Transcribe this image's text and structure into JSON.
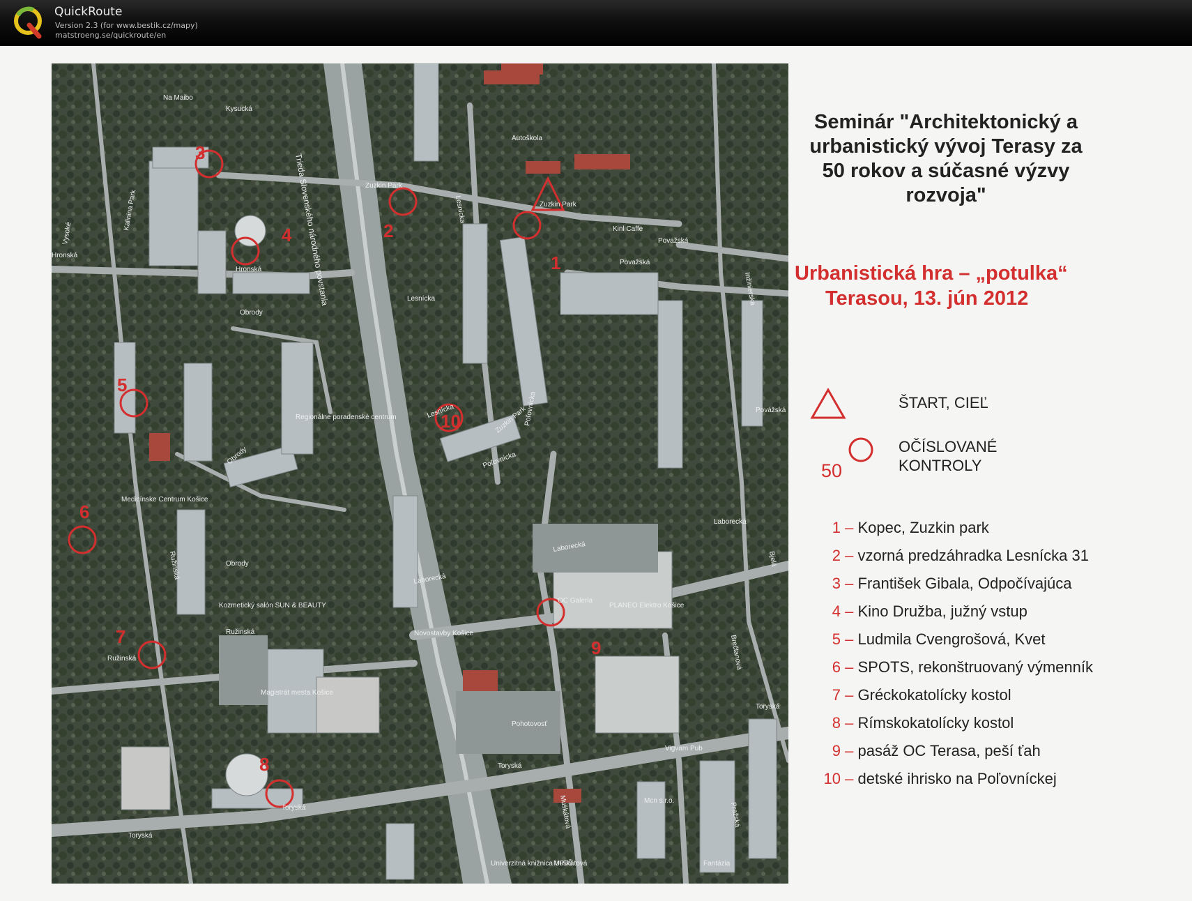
{
  "app": {
    "title": "QuickRoute",
    "version": "Version 2.3  (for www.bestik.cz/mapy)",
    "url": "matstroeng.se/quickroute/en"
  },
  "colors": {
    "accent_red": "#d32f2f",
    "header_bg": "#000000",
    "text_dark": "#222222"
  },
  "seminar": {
    "title_lines": [
      "Seminár \"Architektonický a",
      "urbanistický vývoj Terasy za",
      "50 rokov a súčasné výzvy",
      "rozvoja\""
    ],
    "subtitle_lines": [
      "Urbanistická hra – „potulka“",
      "Terasou, 13. jún 2012"
    ]
  },
  "legend": {
    "start_label": "ŠTART, CIEĽ",
    "control_num": "50",
    "control_label_1": "OČÍSLOVANÉ",
    "control_label_2": "KONTROLY"
  },
  "controls": [
    {
      "num": "1",
      "text": "Kopec, Zuzkin park"
    },
    {
      "num": "2",
      "text": "vzorná predzáhradka Lesnícka 31"
    },
    {
      "num": "3",
      "text": "František Gibala, Odpočívajúca"
    },
    {
      "num": "4",
      "text": "Kino Družba, južný vstup"
    },
    {
      "num": "5",
      "text": "Ludmila Cvengrošová, Kvet"
    },
    {
      "num": "6",
      "text": "SPOTS, rekonštruovaný výmenník"
    },
    {
      "num": "7",
      "text": "Gréckokatolícky kostol"
    },
    {
      "num": "8",
      "text": "Rímskokatolícky kostol"
    },
    {
      "num": "9",
      "text": "pasáž OC Terasa, peší ťah"
    },
    {
      "num": "10",
      "text": "detské ihrisko na Poľovníckej"
    }
  ],
  "map": {
    "control_labels": [
      "1",
      "2",
      "3",
      "4",
      "5",
      "6",
      "7",
      "8",
      "9",
      "10"
    ],
    "street_labels": [
      "Na Maibo",
      "Kysucká",
      "Vysoké",
      "Kalinina Park",
      "Hronská",
      "Hronská",
      "Obrody",
      "Zuzkin Park",
      "Lesnícka",
      "Zuzkin Park",
      "Považská",
      "Považská",
      "Lesnícka",
      "Trieda Slovenského národného povstania",
      "Lesnícka",
      "Zuzkin Park",
      "Poľovnícka",
      "Poľovnícka",
      "Regionálne poradenské centrum",
      "Medicínske Centrum Košice",
      "Obrody",
      "Obrody",
      "Ružinská",
      "Kozmetický salón SUN & BEAUTY",
      "Ružinská",
      "Ružinská",
      "Laborecká",
      "Laborecká",
      "Laborecká",
      "Novostavby Košice",
      "OC Galeria",
      "PLANEO Elektro Košice",
      "Magistrát mesta Košice",
      "Pohotovosť",
      "Toryská",
      "Toryská",
      "Toryská",
      "Vigvam Pub",
      "Muškátová",
      "Muškátová",
      "Mcn s.r.o.",
      "Pražská",
      "Fantázia",
      "Univerzitná knižnica UPJŠ",
      "Brečtanová",
      "Toryská",
      "Autoškola",
      "Kinl Caffe",
      "Povážská",
      "Bjelá",
      "Inžinierska"
    ]
  }
}
